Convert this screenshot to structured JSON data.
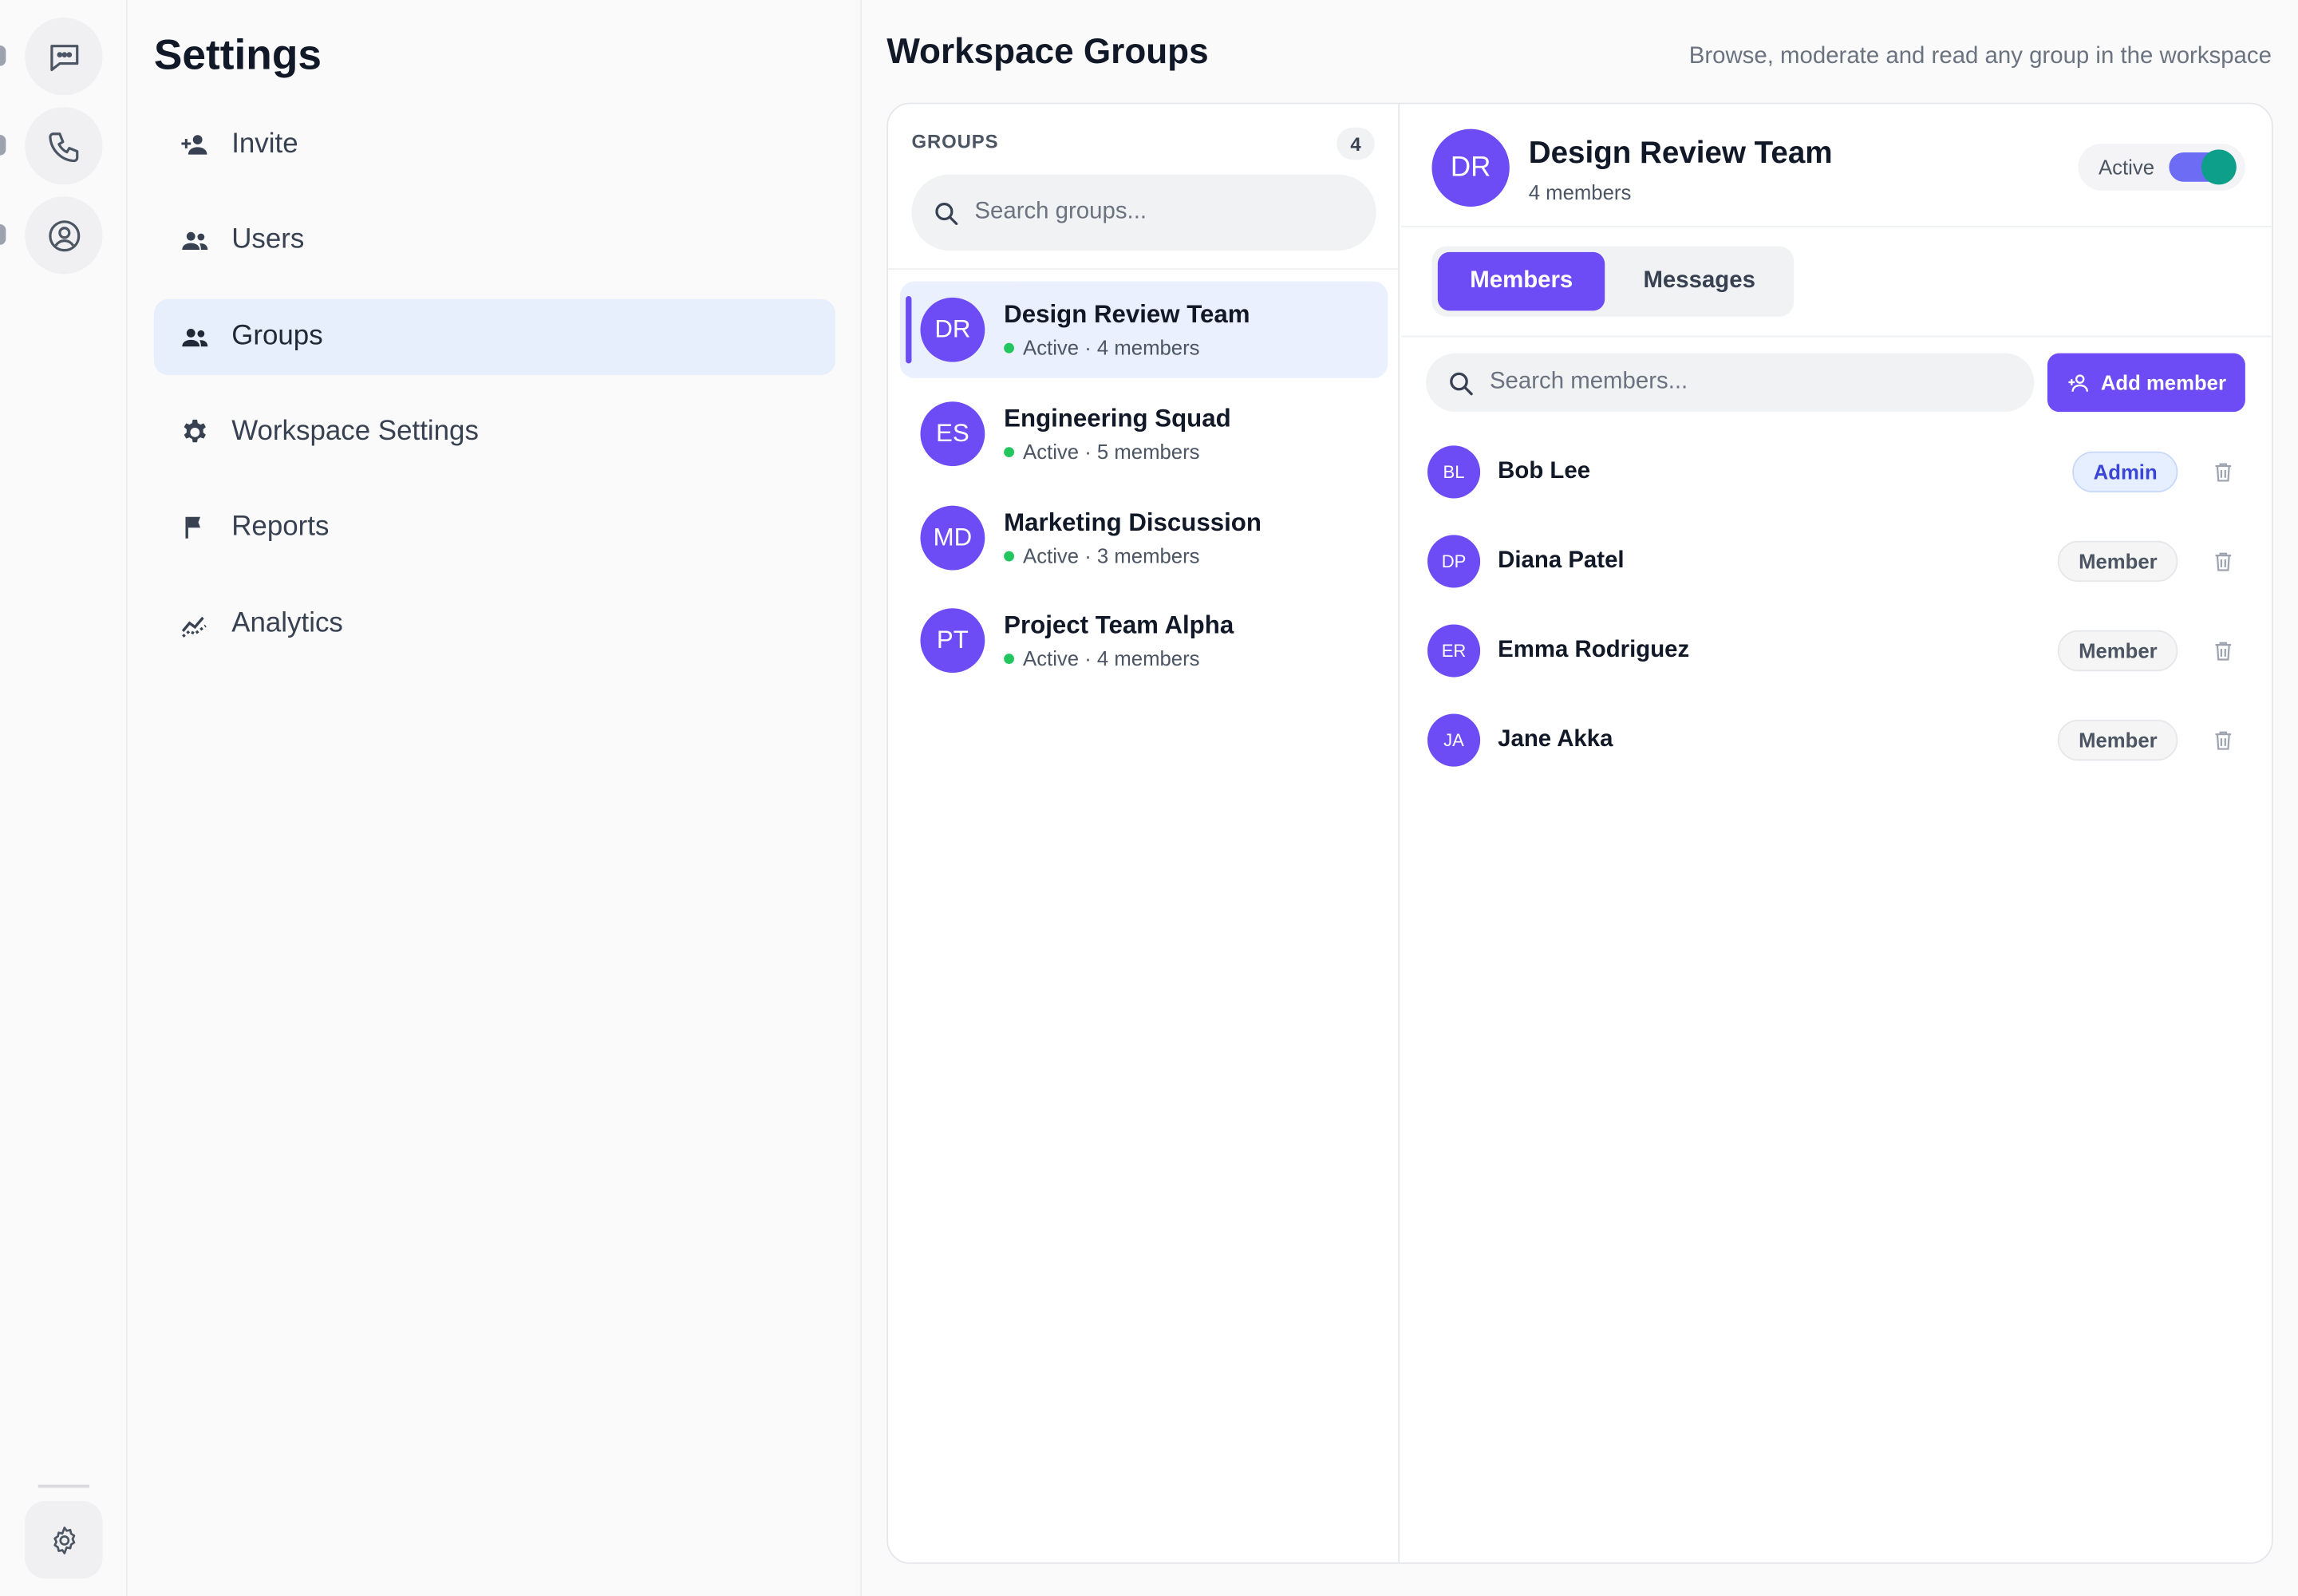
{
  "nav": {
    "title": "Settings",
    "items": [
      {
        "label": "Invite",
        "icon": "person-add-icon",
        "active": false
      },
      {
        "label": "Users",
        "icon": "users-icon",
        "active": false
      },
      {
        "label": "Groups",
        "icon": "groups-icon",
        "active": true
      },
      {
        "label": "Workspace Settings",
        "icon": "gear-icon",
        "active": false
      },
      {
        "label": "Reports",
        "icon": "flag-icon",
        "active": false
      },
      {
        "label": "Analytics",
        "icon": "analytics-icon",
        "active": false
      }
    ]
  },
  "main": {
    "title": "Workspace Groups",
    "subtitle": "Browse, moderate and read any group in the workspace"
  },
  "groups": {
    "heading": "GROUPS",
    "count": "4",
    "search_placeholder": "Search groups...",
    "items": [
      {
        "initials": "DR",
        "name": "Design Review Team",
        "meta": "Active · 4 members",
        "selected": true
      },
      {
        "initials": "ES",
        "name": "Engineering Squad",
        "meta": "Active · 5 members",
        "selected": false
      },
      {
        "initials": "MD",
        "name": "Marketing Discussion",
        "meta": "Active · 3 members",
        "selected": false
      },
      {
        "initials": "PT",
        "name": "Project Team Alpha",
        "meta": "Active · 4 members",
        "selected": false
      }
    ]
  },
  "detail": {
    "initials": "DR",
    "name": "Design Review Team",
    "member_count": "4 members",
    "status_label": "Active",
    "tabs": [
      {
        "label": "Members",
        "active": true
      },
      {
        "label": "Messages",
        "active": false
      }
    ],
    "search_placeholder": "Search members...",
    "add_label": "Add member",
    "members": [
      {
        "initials": "BL",
        "name": "Bob Lee",
        "role": "Admin"
      },
      {
        "initials": "DP",
        "name": "Diana Patel",
        "role": "Member"
      },
      {
        "initials": "ER",
        "name": "Emma Rodriguez",
        "role": "Member"
      },
      {
        "initials": "JA",
        "name": "Jane Akka",
        "role": "Member"
      }
    ]
  },
  "colors": {
    "accent": "#6d4cf5",
    "active_nav_bg": "#e8effc",
    "status_green": "#22c55e",
    "toggle_knob": "#0e9f8a"
  }
}
